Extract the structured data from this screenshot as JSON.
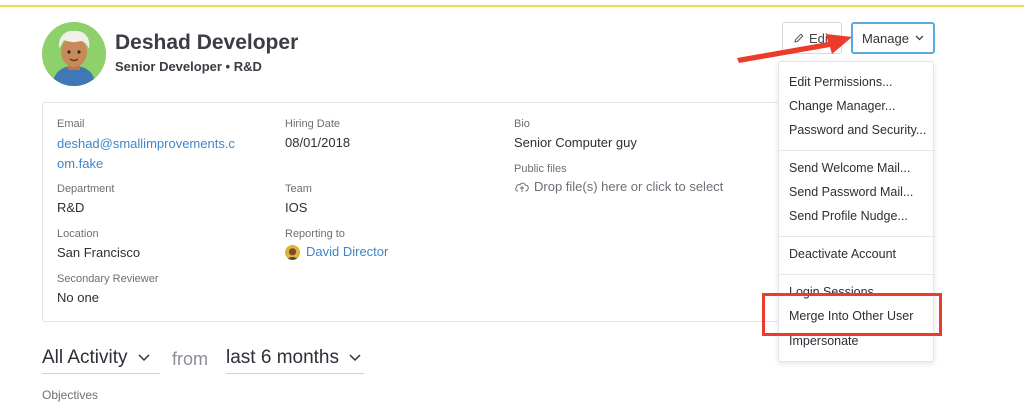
{
  "profile": {
    "name": "Deshad Developer",
    "subtitle": "Senior Developer • R&D"
  },
  "actions": {
    "edit_label": "Edit",
    "manage_label": "Manage"
  },
  "details": {
    "email_label": "Email",
    "email_value": "deshad@smallimprovements.com.fake",
    "hiring_label": "Hiring Date",
    "hiring_value": "08/01/2018",
    "bio_label": "Bio",
    "bio_value": "Senior Computer guy",
    "department_label": "Department",
    "department_value": "R&D",
    "team_label": "Team",
    "team_value": "IOS",
    "public_files_label": "Public files",
    "public_files_placeholder": "Drop file(s) here or click to select",
    "location_label": "Location",
    "location_value": "San Francisco",
    "reporting_label": "Reporting to",
    "reporting_value": "David Director",
    "secondary_label": "Secondary Reviewer",
    "secondary_value": "No one"
  },
  "manage_menu": {
    "items": [
      "Edit Permissions...",
      "Change Manager...",
      "Password and Security...",
      "Send Welcome Mail...",
      "Send Password Mail...",
      "Send Profile Nudge...",
      "Deactivate Account",
      "Login Sessions",
      "Merge Into Other User",
      "Impersonate"
    ]
  },
  "activity": {
    "filter_label": "All Activity",
    "from_label": "from",
    "range_label": "last 6 months",
    "next_item": "Objectives"
  },
  "colors": {
    "link": "#3e86c9",
    "manage_border": "#5aa9df",
    "annotation_red": "#ec3b2a",
    "avatar_bg": "#8ed16b",
    "top_rule": "#f1d94a"
  }
}
